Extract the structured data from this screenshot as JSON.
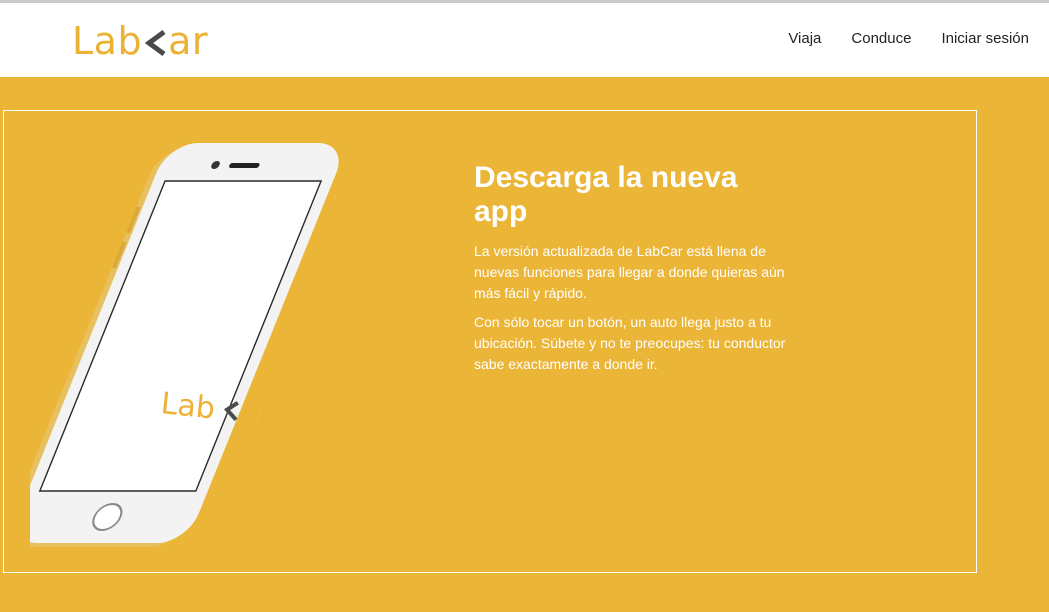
{
  "header": {
    "logo": {
      "prefix": "Lab",
      "suffix": "ar"
    },
    "nav": [
      "Viaja",
      "Conduce",
      "Iniciar sesión"
    ]
  },
  "hero": {
    "title": "Descarga la nueva app",
    "paragraphs": [
      "La versión actualizada de LabCar está llena de nuevas funciones para llegar a donde quieras aún más fácil y rápido.",
      "Con sólo tocar un botón, un auto llega justo a tu ubicación. Súbete y no te preocupes: tu conductor sabe exactamente a donde ir."
    ],
    "phone_logo": {
      "prefix": "Lab",
      "suffix": "ar"
    }
  },
  "colors": {
    "brand_yellow": "#ebb537",
    "logo_yellow": "#ebb236",
    "arrow_gray": "#4a4a4a"
  },
  "icons": {
    "logo_arrow": "left-chevron-arrow-icon"
  }
}
